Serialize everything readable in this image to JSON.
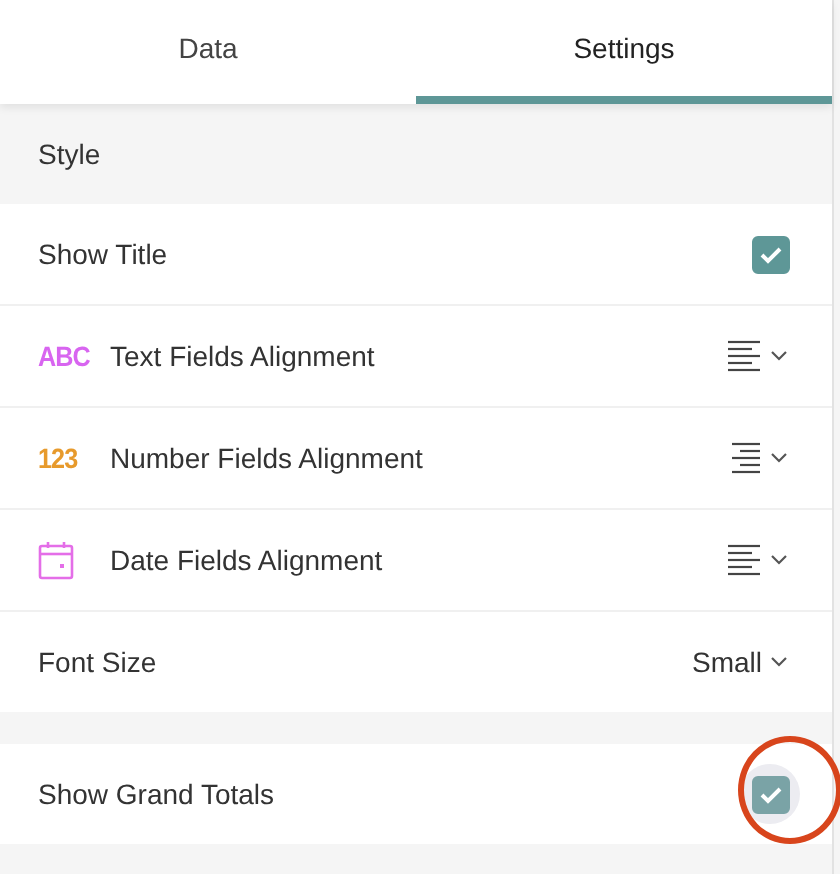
{
  "tabs": [
    {
      "label": "Data",
      "selected": false
    },
    {
      "label": "Settings",
      "selected": true
    }
  ],
  "sections": [
    {
      "title": "Style",
      "rows": [
        {
          "kind": "checkbox",
          "label": "Show Title",
          "checked": true,
          "focused": false,
          "highlighted": false
        },
        {
          "kind": "alignment",
          "badge": "ABC",
          "color": "#d865f0",
          "label": "Text Fields Alignment",
          "align_right": false
        },
        {
          "kind": "alignment",
          "badge": "123",
          "color": "#e79a2c",
          "label": "Number Fields Alignment",
          "align_right": true
        },
        {
          "kind": "alignment",
          "label": "Date Fields Alignment",
          "align_right": false
        },
        {
          "kind": "select",
          "label": "Font Size",
          "value": "Small"
        }
      ]
    },
    {
      "rows": [
        {
          "kind": "checkbox",
          "label": "Show Grand Totals",
          "checked": true,
          "focused": true,
          "highlighted": true
        }
      ]
    }
  ]
}
